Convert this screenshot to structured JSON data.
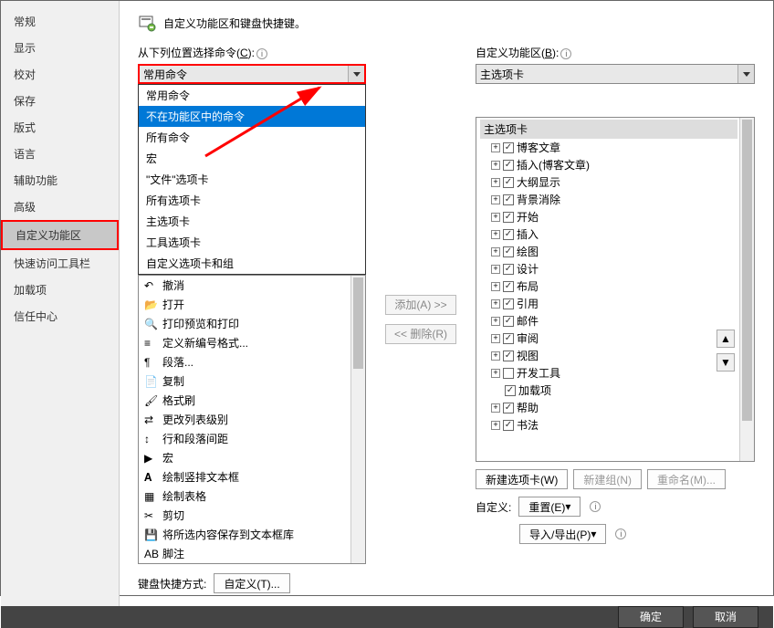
{
  "header": {
    "title": "自定义功能区和键盘快捷键。"
  },
  "sidebar": {
    "items": [
      "常规",
      "显示",
      "校对",
      "保存",
      "版式",
      "语言",
      "辅助功能",
      "高级",
      "自定义功能区",
      "快速访问工具栏",
      "加载项",
      "信任中心"
    ],
    "selectedIndex": 8
  },
  "leftSection": {
    "label_prefix": "从下列位置选择命令(",
    "label_accel": "C",
    "label_suffix": "):",
    "combo_value": "常用命令",
    "dropdown": {
      "items": [
        "常用命令",
        "不在功能区中的命令",
        "所有命令",
        "宏",
        "\"文件\"选项卡",
        "所有选项卡",
        "主选项卡",
        "工具选项卡",
        "自定义选项卡和组"
      ],
      "selectedIndex": 1
    },
    "commands": [
      {
        "icon": "undo",
        "label": "撤消",
        "hasSub": true
      },
      {
        "icon": "open",
        "label": "打开"
      },
      {
        "icon": "preview",
        "label": "打印预览和打印"
      },
      {
        "icon": "numfmt",
        "label": "定义新编号格式..."
      },
      {
        "icon": "para",
        "label": "段落...",
        "hasSub": true
      },
      {
        "icon": "copy",
        "label": "复制"
      },
      {
        "icon": "fmtpaint",
        "label": "格式刷"
      },
      {
        "icon": "listlevel",
        "label": "更改列表级别",
        "hasSub": true
      },
      {
        "icon": "linespace",
        "label": "行和段落间距",
        "hasSub": true
      },
      {
        "icon": "macro",
        "label": "宏",
        "hasSub": true
      },
      {
        "icon": "vtext",
        "label": "绘制竖排文本框"
      },
      {
        "icon": "table",
        "label": "绘制表格"
      },
      {
        "icon": "cut",
        "label": "剪切"
      },
      {
        "icon": "saveblock",
        "label": "将所选内容保存到文本框库"
      },
      {
        "icon": "footer",
        "label": "脚注"
      }
    ]
  },
  "midButtons": {
    "add": "添加(A) >>",
    "remove": "<< 删除(R)"
  },
  "rightSection": {
    "label_prefix": "自定义功能区(",
    "label_accel": "B",
    "label_suffix": "):",
    "combo_value": "主选项卡",
    "tree": {
      "root": "主选项卡",
      "items": [
        {
          "label": "博客文章",
          "checked": true
        },
        {
          "label": "插入(博客文章)",
          "checked": true
        },
        {
          "label": "大纲显示",
          "checked": true
        },
        {
          "label": "背景消除",
          "checked": true
        },
        {
          "label": "开始",
          "checked": true
        },
        {
          "label": "插入",
          "checked": true
        },
        {
          "label": "绘图",
          "checked": true
        },
        {
          "label": "设计",
          "checked": true
        },
        {
          "label": "布局",
          "checked": true
        },
        {
          "label": "引用",
          "checked": true
        },
        {
          "label": "邮件",
          "checked": true
        },
        {
          "label": "审阅",
          "checked": true
        },
        {
          "label": "视图",
          "checked": true
        },
        {
          "label": "开发工具",
          "checked": false
        },
        {
          "label": "加载项",
          "checked": true,
          "noExpand": true
        },
        {
          "label": "帮助",
          "checked": true
        },
        {
          "label": "书法",
          "checked": true
        }
      ]
    },
    "buttons": {
      "newTab": "新建选项卡(W)",
      "newGroup": "新建组(N)",
      "rename": "重命名(M)..."
    },
    "customize": {
      "label": "自定义:",
      "reset": "重置(E)",
      "importExport": "导入/导出(P)"
    }
  },
  "keyboard": {
    "label": "键盘快捷方式:",
    "button": "自定义(T)..."
  },
  "footer": {
    "ok": "确定",
    "cancel": "取消"
  },
  "spin": {
    "up": "▲",
    "down": "▼"
  }
}
